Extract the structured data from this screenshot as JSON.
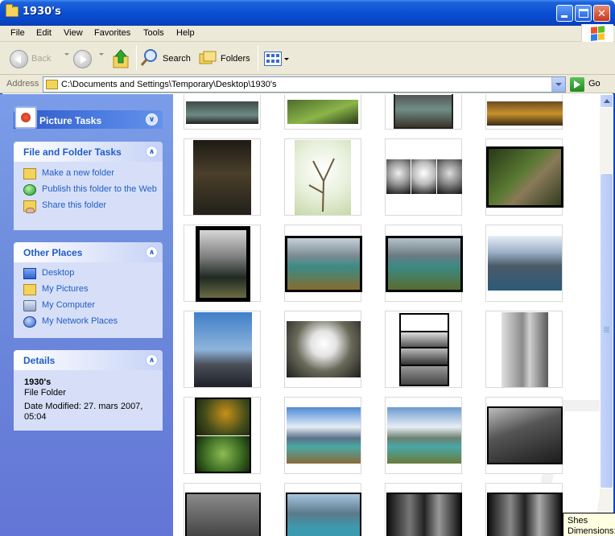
{
  "window": {
    "title": "1930's",
    "controls": [
      "minimize",
      "maximize",
      "close"
    ]
  },
  "menu": [
    "File",
    "Edit",
    "View",
    "Favorites",
    "Tools",
    "Help"
  ],
  "toolbar": {
    "back_label": "Back",
    "search_label": "Search",
    "folders_label": "Folders"
  },
  "address": {
    "label": "Address",
    "path": "C:\\Documents and Settings\\Temporary\\Desktop\\1930's",
    "go_label": "Go"
  },
  "taskpane": {
    "picture_tasks": {
      "title": "Picture Tasks"
    },
    "file_folder_tasks": {
      "title": "File and Folder Tasks",
      "items": [
        "Make a new folder",
        "Publish this folder to the Web",
        "Share this folder"
      ]
    },
    "other_places": {
      "title": "Other Places",
      "items": [
        "Desktop",
        "My Pictures",
        "My Computer",
        "My Network Places"
      ]
    },
    "details": {
      "title": "Details",
      "name": "1930's",
      "type": "File Folder",
      "modified": "Date Modified: 27. mars 2007, 05:04"
    }
  },
  "tooltip": {
    "line1": "Shes",
    "line2": "Dimensions:"
  },
  "colors": {
    "titlebar": "#0a4fd2",
    "taskpane": "#6d8cdc",
    "panel_body": "#d6dff7",
    "link": "#215dc6"
  }
}
